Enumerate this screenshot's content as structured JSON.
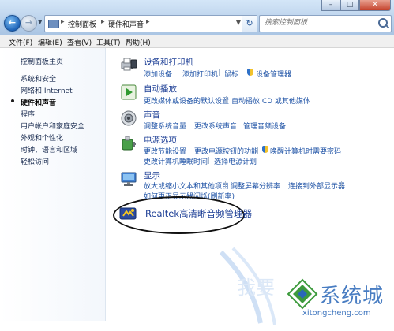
{
  "address_bar": {
    "crumbs": [
      "控制面板",
      "硬件和声音"
    ],
    "separator": "▸"
  },
  "search": {
    "placeholder": "搜索控制面板"
  },
  "window_buttons": {
    "minimize": "–",
    "maximize": "□",
    "close": "✕"
  },
  "menu": {
    "items": [
      "文件(F)",
      "编辑(E)",
      "查看(V)",
      "工具(T)",
      "帮助(H)"
    ]
  },
  "sidebar": {
    "items": [
      {
        "label": "控制面板主页"
      },
      {
        "label": "系统和安全"
      },
      {
        "label": "网络和 Internet"
      },
      {
        "label": "硬件和声音",
        "current": true
      },
      {
        "label": "程序"
      },
      {
        "label": "用户帐户和家庭安全"
      },
      {
        "label": "外观和个性化"
      },
      {
        "label": "时钟、语言和区域"
      },
      {
        "label": "轻松访问"
      }
    ]
  },
  "categories": [
    {
      "title": "设备和打印机",
      "icon": "printer-icon",
      "tasks": [
        "添加设备",
        "添加打印机",
        "鼠标",
        "设备管理器"
      ]
    },
    {
      "title": "自动播放",
      "icon": "autoplay-icon",
      "tasks": [
        "更改媒体或设备的默认设置",
        "自动播放 CD 或其他媒体"
      ]
    },
    {
      "title": "声音",
      "icon": "speaker-icon",
      "tasks": [
        "调整系统音量",
        "更改系统声音",
        "管理音频设备"
      ]
    },
    {
      "title": "电源选项",
      "icon": "power-icon",
      "tasks": [
        "更改节能设置",
        "更改电源按钮的功能",
        "唤醒计算机时需要密码",
        "更改计算机睡眠时间",
        "选择电源计划"
      ]
    },
    {
      "title": "显示",
      "icon": "display-icon",
      "tasks": [
        "放大或缩小文本和其他项目",
        "调整屏幕分辨率",
        "连接到外部显示器",
        "如何更正显示器闪烁(刷新率)"
      ]
    },
    {
      "title": "Realtek高清晰音频管理器",
      "icon": "realtek-icon",
      "tasks": []
    }
  ],
  "watermark": {
    "text": "系统城",
    "url": "xitongcheng.com",
    "faint": "我要"
  }
}
